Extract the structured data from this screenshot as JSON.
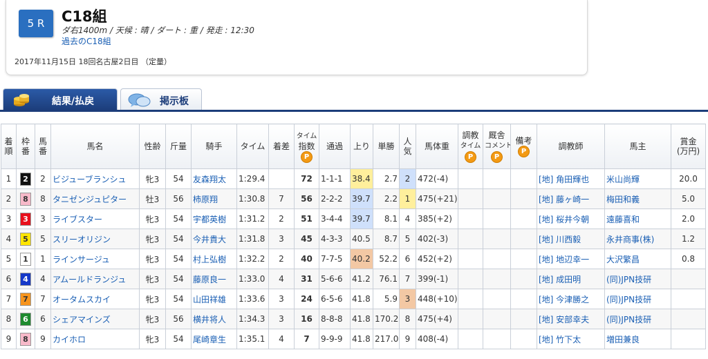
{
  "race": {
    "number": "5 R",
    "title": "C18組",
    "info": "ダ右1400m / 天候 : 晴 / ダート : 重 / 発走 : 12:30",
    "past_link": "過去のC18組",
    "date": "2017年11月15日 18回名古屋2日目 （定量）"
  },
  "tabs": [
    {
      "label": "結果/払戻",
      "icon": "coin-stack-icon",
      "active": true
    },
    {
      "label": "掲示板",
      "icon": "speech-bubble-icon",
      "active": false
    }
  ],
  "table": {
    "headers": {
      "chakujun": [
        "着",
        "順"
      ],
      "waku": [
        "枠",
        "番"
      ],
      "umaban": [
        "馬",
        "番"
      ],
      "horse": "馬名",
      "sex_age": "性齢",
      "weight": "斤量",
      "jockey": "騎手",
      "time": "タイム",
      "margin": "着差",
      "time_index": [
        "タイム",
        "指数"
      ],
      "passing": "通過",
      "last3f": "上り",
      "odds": "単勝",
      "popularity": [
        "人",
        "気"
      ],
      "body_weight": "馬体重",
      "training_time": [
        "調教",
        "タイム"
      ],
      "stable_comment": [
        "厩舎",
        "コメント"
      ],
      "remarks": "備考",
      "trainer": "調教師",
      "owner": "馬主",
      "prize": [
        "賞金",
        "(万円)"
      ],
      "p_badge": "P"
    },
    "rows": [
      {
        "rank": "1",
        "waku": "2",
        "umaban": "2",
        "horse": "ビジューブランシュ",
        "sex_age": "牝3",
        "weight": "54",
        "jockey": "友森翔太",
        "time": "1:29.4",
        "margin": "",
        "index": "72",
        "passing": "1-1-1",
        "last3f": "38.4",
        "odds": "2.7",
        "pop": "2",
        "body": "472(-4)",
        "trainer": "[地] 角田輝也",
        "owner": "米山尚輝",
        "prize": "20.0",
        "waku_bg": "#111111",
        "waku_fg": "#ffffff",
        "l3_hl": "hi-y",
        "pop_hl": "hi-b"
      },
      {
        "rank": "2",
        "waku": "8",
        "umaban": "8",
        "horse": "タニゼンジュピター",
        "sex_age": "牡3",
        "weight": "56",
        "jockey": "柿原翔",
        "time": "1:30.8",
        "margin": "7",
        "index": "56",
        "passing": "2-2-2",
        "last3f": "39.7",
        "odds": "2.2",
        "pop": "1",
        "body": "475(+21)",
        "trainer": "[地] 藤ヶ崎一",
        "owner": "梅田和義",
        "prize": "5.0",
        "waku_bg": "#f7b9c9",
        "waku_fg": "#333333",
        "l3_hl": "hi-b",
        "pop_hl": "hi-y"
      },
      {
        "rank": "3",
        "waku": "3",
        "umaban": "3",
        "horse": "ライブスター",
        "sex_age": "牝3",
        "weight": "54",
        "jockey": "宇都英樹",
        "time": "1:31.2",
        "margin": "2",
        "index": "51",
        "passing": "3-4-4",
        "last3f": "39.7",
        "odds": "8.1",
        "pop": "4",
        "body": "385(+2)",
        "trainer": "[地] 桜井今朝",
        "owner": "遠藤喜和",
        "prize": "2.0",
        "waku_bg": "#e8101c",
        "waku_fg": "#ffffff",
        "l3_hl": "hi-b",
        "pop_hl": ""
      },
      {
        "rank": "4",
        "waku": "5",
        "umaban": "5",
        "horse": "スリーオリジン",
        "sex_age": "牝3",
        "weight": "54",
        "jockey": "今井貴大",
        "time": "1:31.8",
        "margin": "3",
        "index": "45",
        "passing": "4-3-3",
        "last3f": "40.5",
        "odds": "8.7",
        "pop": "5",
        "body": "402(-3)",
        "trainer": "[地] 川西毅",
        "owner": "永井商事(株)",
        "prize": "1.2",
        "waku_bg": "#ffe500",
        "waku_fg": "#333333",
        "l3_hl": "",
        "pop_hl": ""
      },
      {
        "rank": "5",
        "waku": "1",
        "umaban": "1",
        "horse": "ラインサージュ",
        "sex_age": "牝3",
        "weight": "54",
        "jockey": "村上弘樹",
        "time": "1:32.2",
        "margin": "2",
        "index": "40",
        "passing": "7-7-5",
        "last3f": "40.2",
        "odds": "52.2",
        "pop": "6",
        "body": "452(+2)",
        "trainer": "[地] 地辺幸一",
        "owner": "大沢繁昌",
        "prize": "0.8",
        "waku_bg": "#ffffff",
        "waku_fg": "#333333",
        "l3_hl": "hi-o",
        "pop_hl": ""
      },
      {
        "rank": "6",
        "waku": "4",
        "umaban": "4",
        "horse": "アムールドランジュ",
        "sex_age": "牝3",
        "weight": "54",
        "jockey": "藤原良一",
        "time": "1:33.0",
        "margin": "4",
        "index": "31",
        "passing": "5-6-6",
        "last3f": "41.2",
        "odds": "76.1",
        "pop": "7",
        "body": "399(-1)",
        "trainer": "[地] 成田明",
        "owner": "(同)JPN技研",
        "prize": "",
        "waku_bg": "#1538c8",
        "waku_fg": "#ffffff",
        "l3_hl": "",
        "pop_hl": ""
      },
      {
        "rank": "7",
        "waku": "7",
        "umaban": "7",
        "horse": "オータムスカイ",
        "sex_age": "牝3",
        "weight": "54",
        "jockey": "山田祥雄",
        "time": "1:33.6",
        "margin": "3",
        "index": "24",
        "passing": "6-5-6",
        "last3f": "41.8",
        "odds": "5.9",
        "pop": "3",
        "body": "448(+10)",
        "trainer": "[地] 今津勝之",
        "owner": "(同)JPN技研",
        "prize": "",
        "waku_bg": "#f7941d",
        "waku_fg": "#333333",
        "l3_hl": "",
        "pop_hl": "hi-o"
      },
      {
        "rank": "8",
        "waku": "6",
        "umaban": "6",
        "horse": "シェアマインズ",
        "sex_age": "牝3",
        "weight": "56",
        "jockey": "横井将人",
        "time": "1:34.3",
        "margin": "3",
        "index": "16",
        "passing": "8-8-8",
        "last3f": "41.8",
        "odds": "170.2",
        "pop": "8",
        "body": "475(+4)",
        "trainer": "[地] 安部幸夫",
        "owner": "(同)JPN技研",
        "prize": "",
        "waku_bg": "#1e8a2f",
        "waku_fg": "#ffffff",
        "l3_hl": "",
        "pop_hl": ""
      },
      {
        "rank": "9",
        "waku": "8",
        "umaban": "9",
        "horse": "カイホロ",
        "sex_age": "牝3",
        "weight": "54",
        "jockey": "尾崎章生",
        "time": "1:35.1",
        "margin": "4",
        "index": "7",
        "passing": "9-9-9",
        "last3f": "41.8",
        "odds": "217.0",
        "pop": "9",
        "body": "408(-4)",
        "trainer": "[地] 竹下太",
        "owner": "増田兼良",
        "prize": "",
        "waku_bg": "#f7b9c9",
        "waku_fg": "#333333",
        "l3_hl": "",
        "pop_hl": ""
      }
    ]
  }
}
